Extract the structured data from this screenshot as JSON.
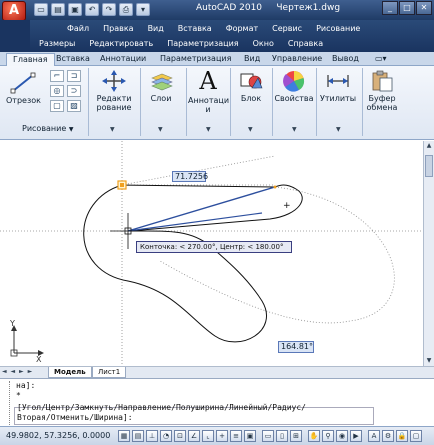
{
  "window": {
    "app_button_label": "A",
    "title": "AutoCAD 2010",
    "document": "Чертеж1.dwg",
    "controls": [
      "_",
      "□",
      "✕"
    ]
  },
  "menu": {
    "row1": [
      "Файл",
      "Правка",
      "Вид",
      "Вставка",
      "Формат",
      "Сервис",
      "Рисование"
    ],
    "row2": [
      "Размеры",
      "Редактировать",
      "Параметризация",
      "Окно",
      "Справка"
    ]
  },
  "ribbon_tabs": [
    "Главная",
    "Вставка",
    "Аннотации",
    "Параметризация",
    "Вид",
    "Управление",
    "Вывод"
  ],
  "ribbon": {
    "polyline_label": "Отрезок",
    "draw_panel_label": "Рисование",
    "edit_label_1": "Редакти",
    "edit_label_2": "рование",
    "layers_label": "Слои",
    "annot_label_1": "Аннотаци",
    "annot_label_2": "и",
    "block_label": "Блок",
    "props_label": "Свойства",
    "utils_label": "Утилиты",
    "clip_label_1": "Буфер",
    "clip_label_2": "обмена",
    "drop_glyph": "▼",
    "annot_glyph": "A"
  },
  "drawing": {
    "dim_input_1": "71.7256",
    "tooltip": "Конточка: < 270.00°,  Центр: < 180.00°",
    "dim_input_2": "164.81°",
    "ucs_x": "X",
    "ucs_y": "Y",
    "colors": {
      "rubber_band": "#2d4f9e",
      "tooltip_bg": "#e6e9f4",
      "tooltip_border": "#3a3f80",
      "dim_bg": "#d9e4f5",
      "grip": "#f0a020"
    }
  },
  "layout_tabs": {
    "nav": "◄ ◄ ► ►",
    "model": "Модель",
    "sheet": "Лист1"
  },
  "command": {
    "line1": "на]:",
    "line2": "*",
    "line3": "[Угол/Центр/Замкнуть/Направление/Полуширина/Линейный/Радиус/",
    "line4": "Вторая/Отменить/Ширина]:"
  },
  "status": {
    "coords": "49.9802, 57.3256, 0.0000"
  }
}
